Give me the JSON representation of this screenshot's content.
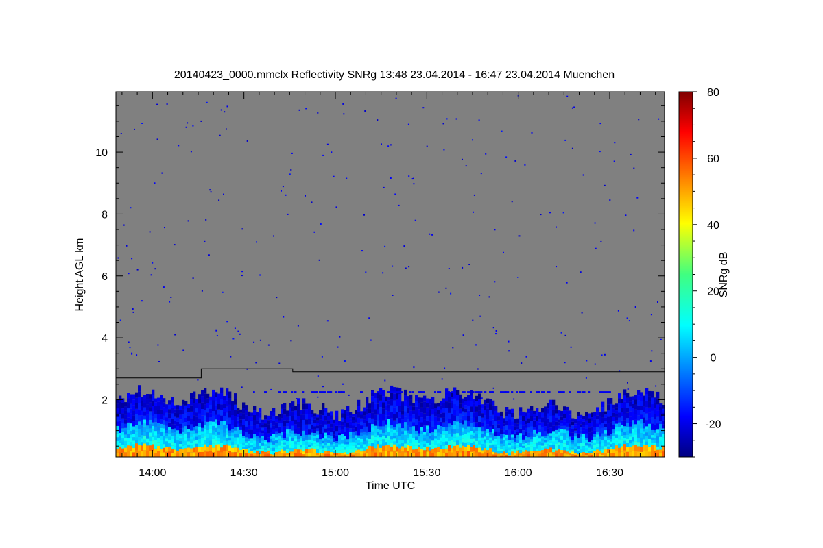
{
  "chart_data": {
    "type": "heatmap",
    "title": "20140423_0000.mmclx Reflectivity SNRg   13:48 23.04.2014 - 16:47 23.04.2014 Muenchen",
    "xlabel": "Time UTC",
    "ylabel": "Height AGL km",
    "colorbar_label": "SNRg dB",
    "x_range": [
      "13:48",
      "16:48"
    ],
    "y_range": [
      0.15,
      11.95
    ],
    "x_ticks": [
      "14:00",
      "14:30",
      "15:00",
      "15:30",
      "16:00",
      "16:30"
    ],
    "y_ticks": [
      2,
      4,
      6,
      8,
      10
    ],
    "colorbar_range": [
      -30,
      80
    ],
    "colorbar_ticks": [
      -20,
      0,
      20,
      40,
      60,
      80
    ],
    "colormap": "jet",
    "background_color": "#808080",
    "grid": false,
    "bands": [
      {
        "name": "near-surface",
        "top_km": 0.4,
        "snr_db": 50
      },
      {
        "name": "boundary-layer",
        "top_km": 1.0,
        "snr_db": 10
      },
      {
        "name": "upper-boundary-layer",
        "top_km": 1.9,
        "snr_db": -15
      }
    ],
    "boundary_line": [
      {
        "start": "13:48",
        "end": "14:16",
        "height_km": 2.7
      },
      {
        "start": "14:16",
        "end": "14:46",
        "height_km": 3.0
      },
      {
        "start": "14:46",
        "end": "16:48",
        "height_km": 2.9
      }
    ],
    "secondary_layer_height_km": 2.25
  }
}
